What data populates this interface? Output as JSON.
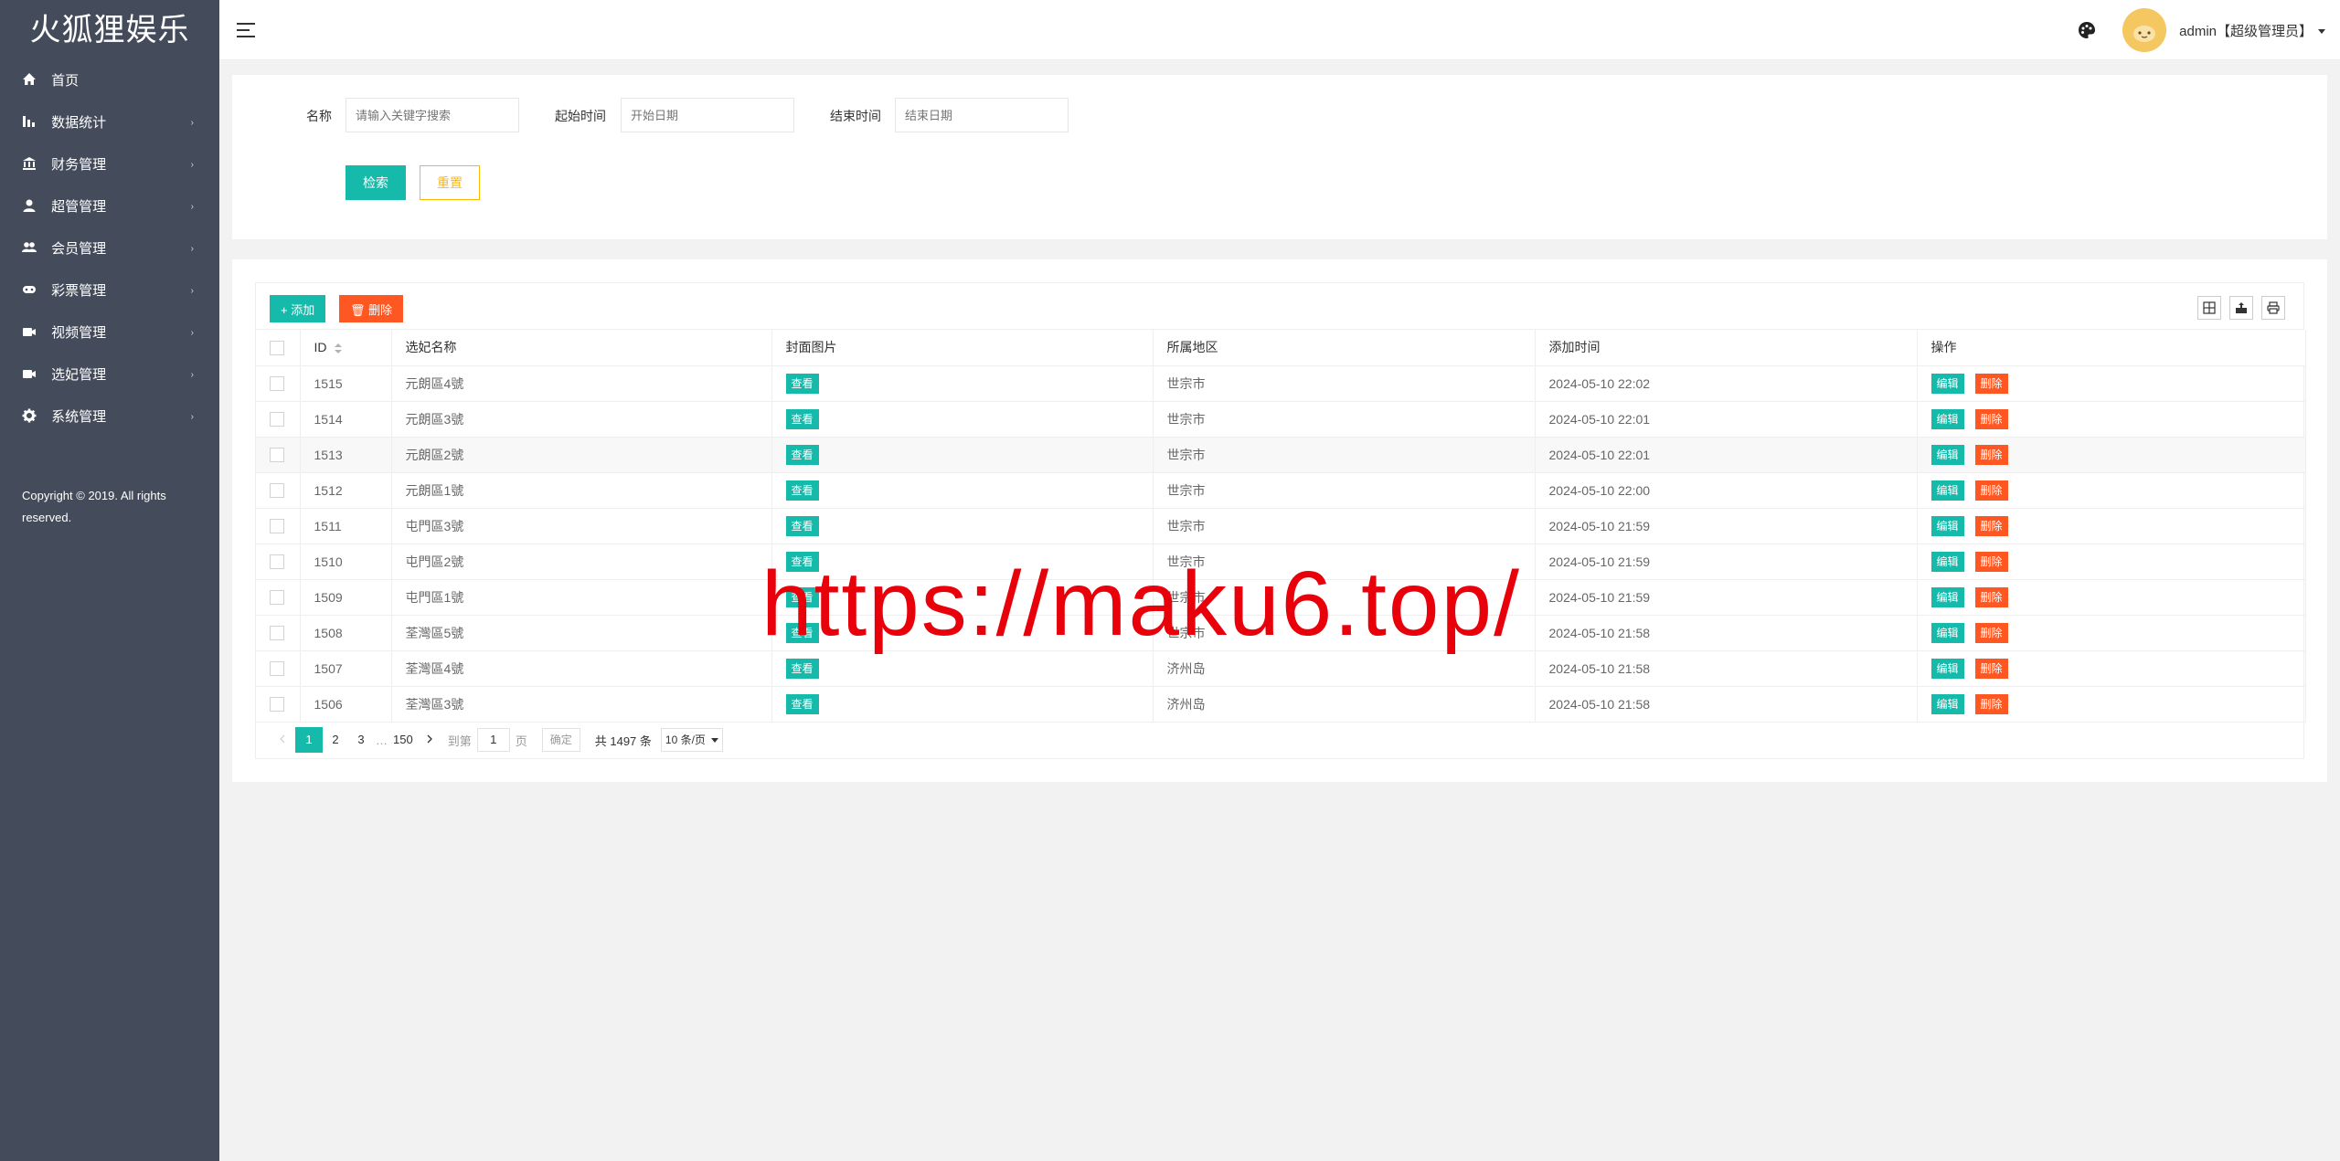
{
  "app": {
    "logo": "火狐狸娱乐"
  },
  "sidebar": {
    "items": [
      {
        "label": "首页",
        "icon": "home-icon",
        "has_arrow": false
      },
      {
        "label": "数据统计",
        "icon": "bar-chart-icon",
        "has_arrow": true
      },
      {
        "label": "财务管理",
        "icon": "bank-icon",
        "has_arrow": true
      },
      {
        "label": "超管管理",
        "icon": "user-icon",
        "has_arrow": true
      },
      {
        "label": "会员管理",
        "icon": "users-icon",
        "has_arrow": true
      },
      {
        "label": "彩票管理",
        "icon": "gamepad-icon",
        "has_arrow": true
      },
      {
        "label": "视频管理",
        "icon": "video-icon",
        "has_arrow": true
      },
      {
        "label": "选妃管理",
        "icon": "video-icon",
        "has_arrow": true
      },
      {
        "label": "系统管理",
        "icon": "gear-icon",
        "has_arrow": true
      }
    ],
    "arrow": "›",
    "copyright": "Copyright © 2019. All rights reserved."
  },
  "header": {
    "user": "admin【超级管理员】"
  },
  "search": {
    "name_label": "名称",
    "name_placeholder": "请输入关键字搜索",
    "start_label": "起始时间",
    "start_placeholder": "开始日期",
    "end_label": "结束时间",
    "end_placeholder": "结束日期",
    "search_button": "检索",
    "reset_button": "重置"
  },
  "toolbar": {
    "add_label": "添加",
    "delete_label": "删除"
  },
  "table": {
    "columns": [
      "ID",
      "选妃名称",
      "封面图片",
      "所属地区",
      "添加时间",
      "操作"
    ],
    "view_label": "查看",
    "edit_label": "编辑",
    "delete_label": "删除",
    "rows": [
      {
        "id": "1515",
        "name": "元朗區4號",
        "region": "世宗市",
        "time": "2024-05-10 22:02"
      },
      {
        "id": "1514",
        "name": "元朗區3號",
        "region": "世宗市",
        "time": "2024-05-10 22:01"
      },
      {
        "id": "1513",
        "name": "元朗區2號",
        "region": "世宗市",
        "time": "2024-05-10 22:01"
      },
      {
        "id": "1512",
        "name": "元朗區1號",
        "region": "世宗市",
        "time": "2024-05-10 22:00"
      },
      {
        "id": "1511",
        "name": "屯門區3號",
        "region": "世宗市",
        "time": "2024-05-10 21:59"
      },
      {
        "id": "1510",
        "name": "屯門區2號",
        "region": "世宗市",
        "time": "2024-05-10 21:59"
      },
      {
        "id": "1509",
        "name": "屯門區1號",
        "region": "世宗市",
        "time": "2024-05-10 21:59"
      },
      {
        "id": "1508",
        "name": "荃灣區5號",
        "region": "世宗市",
        "time": "2024-05-10 21:58"
      },
      {
        "id": "1507",
        "name": "荃灣區4號",
        "region": "济州岛",
        "time": "2024-05-10 21:58"
      },
      {
        "id": "1506",
        "name": "荃灣區3號",
        "region": "济州岛",
        "time": "2024-05-10 21:58"
      }
    ]
  },
  "pagination": {
    "pages": [
      "1",
      "2",
      "3"
    ],
    "ellipsis": "…",
    "last_page": "150",
    "goto_label": "到第",
    "goto_value": "1",
    "page_unit": "页",
    "confirm": "确定",
    "total": "共 1497 条",
    "per_page": "10 条/页"
  },
  "watermark": "https://maku6.top/",
  "colors": {
    "sidebar": "#444c5b",
    "primary": "#16baaa",
    "danger": "#ff5722",
    "warning": "#ffb800",
    "watermark": "#e8000a"
  }
}
